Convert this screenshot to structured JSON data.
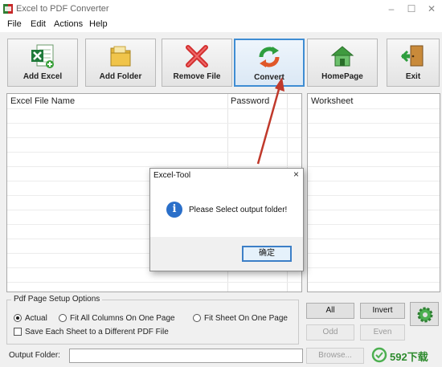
{
  "window": {
    "title": "Excel to PDF Converter",
    "app_icon": "excel-pdf-app-icon"
  },
  "menu": [
    "File",
    "Edit",
    "Actions",
    "Help"
  ],
  "toolbar": [
    {
      "label": "Add Excel",
      "icon": "excel-file-icon"
    },
    {
      "label": "Add Folder",
      "icon": "folder-icon"
    },
    {
      "label": "Remove File",
      "icon": "red-x-icon"
    },
    {
      "label": "Convert",
      "icon": "convert-arrows-icon"
    },
    {
      "label": "HomePage",
      "icon": "house-icon"
    },
    {
      "label": "Exit",
      "icon": "exit-door-icon"
    }
  ],
  "file_list": {
    "col_name": "Excel File Name",
    "col_password": "Password"
  },
  "worksheet_list": {
    "header": "Worksheet"
  },
  "options": {
    "title": "Pdf Page Setup Options",
    "radio_actual": "Actual",
    "radio_fit_columns": "Fit All Columns On One Page",
    "radio_fit_sheet": "Fit Sheet On One Page",
    "selected": "Actual",
    "checkbox_each_sheet": "Save Each Sheet to a Different PDF File"
  },
  "buttons": {
    "all": "All",
    "invert": "Invert",
    "odd": "Odd",
    "even": "Even",
    "browse": "Browse..."
  },
  "output": {
    "label": "Output Folder:",
    "value": ""
  },
  "dialog": {
    "title": "Excel-Tool",
    "message": "Please Select output folder!",
    "ok": "确定"
  },
  "annotation_color": "#c0392b",
  "accent_color": "#3f8dd3",
  "watermark": {
    "text": "592下载"
  }
}
